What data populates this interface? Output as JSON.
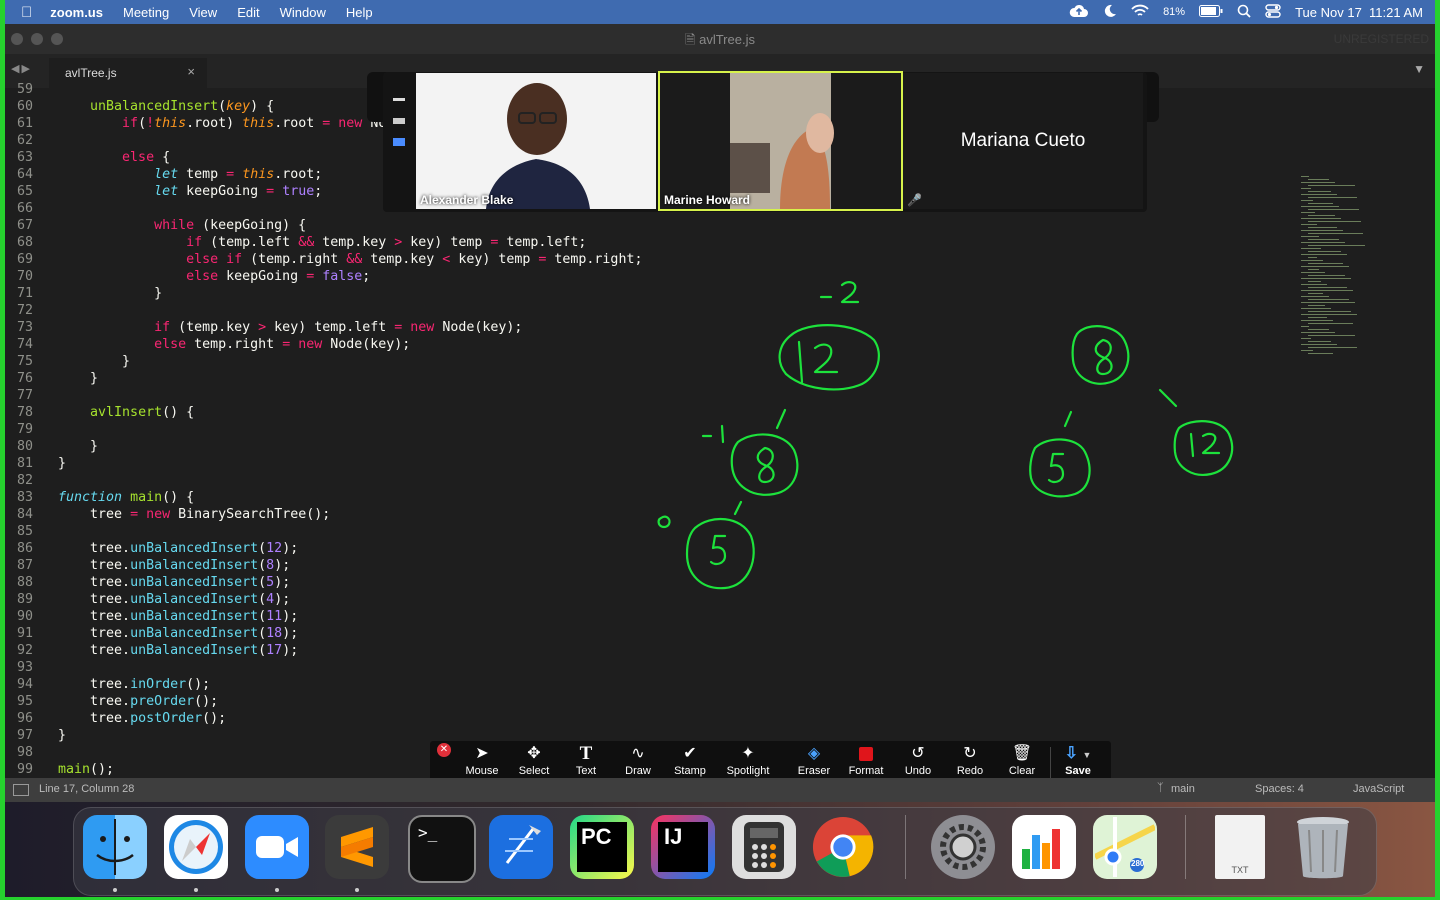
{
  "menubar": {
    "app_name": "zoom.us",
    "items": [
      "Meeting",
      "View",
      "Edit",
      "Window",
      "Help"
    ],
    "battery": "81%",
    "clock": "Tue Nov 17  11:21 AM"
  },
  "editor": {
    "title": "avlTree.js",
    "unregistered": "UNREGISTERED",
    "tab_name": "avlTree.js",
    "status_position": "Line 17, Column 28",
    "branch": "main",
    "spaces": "Spaces: 4",
    "language": "JavaScript"
  },
  "code_lines": [
    {
      "n": "59",
      "t": []
    },
    {
      "n": "60",
      "t": [
        [
          "    ",
          ""
        ],
        [
          "unBalancedInsert",
          "fn"
        ],
        [
          "(",
          ""
        ],
        [
          "key",
          "th"
        ],
        [
          ") {",
          ""
        ]
      ]
    },
    {
      "n": "61",
      "t": [
        [
          "        ",
          ""
        ],
        [
          "if",
          "kw"
        ],
        [
          "(",
          ""
        ],
        [
          "!",
          "kw"
        ],
        [
          "this",
          "th"
        ],
        [
          ".root) ",
          ""
        ],
        [
          "this",
          "th"
        ],
        [
          ".root ",
          ""
        ],
        [
          "=",
          "kw"
        ],
        [
          " ",
          ""
        ],
        [
          "new",
          "kw"
        ],
        [
          " Node(key);",
          ""
        ]
      ]
    },
    {
      "n": "62",
      "t": []
    },
    {
      "n": "63",
      "t": [
        [
          "        ",
          ""
        ],
        [
          "else",
          "kw"
        ],
        [
          " {",
          ""
        ]
      ]
    },
    {
      "n": "64",
      "t": [
        [
          "            ",
          ""
        ],
        [
          "let",
          "st"
        ],
        [
          " temp ",
          ""
        ],
        [
          "=",
          "kw"
        ],
        [
          " ",
          ""
        ],
        [
          "this",
          "th"
        ],
        [
          ".root;",
          ""
        ]
      ]
    },
    {
      "n": "65",
      "t": [
        [
          "            ",
          ""
        ],
        [
          "let",
          "st"
        ],
        [
          " keepGoing ",
          ""
        ],
        [
          "=",
          "kw"
        ],
        [
          " ",
          ""
        ],
        [
          "true",
          "bl"
        ],
        [
          ";",
          ""
        ]
      ]
    },
    {
      "n": "66",
      "t": []
    },
    {
      "n": "67",
      "t": [
        [
          "            ",
          ""
        ],
        [
          "while",
          "kw"
        ],
        [
          " (keepGoing) {",
          ""
        ]
      ]
    },
    {
      "n": "68",
      "t": [
        [
          "                ",
          ""
        ],
        [
          "if",
          "kw"
        ],
        [
          " (temp.left ",
          ""
        ],
        [
          "&&",
          "kw"
        ],
        [
          " temp.key ",
          ""
        ],
        [
          ">",
          "kw"
        ],
        [
          " key) temp ",
          ""
        ],
        [
          "=",
          "kw"
        ],
        [
          " temp.left;",
          ""
        ]
      ]
    },
    {
      "n": "69",
      "t": [
        [
          "                ",
          ""
        ],
        [
          "else if",
          "kw"
        ],
        [
          " (temp.right ",
          ""
        ],
        [
          "&&",
          "kw"
        ],
        [
          " temp.key ",
          ""
        ],
        [
          "<",
          "kw"
        ],
        [
          " key) temp ",
          ""
        ],
        [
          "=",
          "kw"
        ],
        [
          " temp.right;",
          ""
        ]
      ]
    },
    {
      "n": "70",
      "t": [
        [
          "                ",
          ""
        ],
        [
          "else",
          "kw"
        ],
        [
          " keepGoing ",
          ""
        ],
        [
          "=",
          "kw"
        ],
        [
          " ",
          ""
        ],
        [
          "false",
          "bl"
        ],
        [
          ";",
          ""
        ]
      ]
    },
    {
      "n": "71",
      "t": [
        [
          "            }",
          ""
        ]
      ]
    },
    {
      "n": "72",
      "t": []
    },
    {
      "n": "73",
      "t": [
        [
          "            ",
          ""
        ],
        [
          "if",
          "kw"
        ],
        [
          " (temp.key ",
          ""
        ],
        [
          ">",
          "kw"
        ],
        [
          " key) temp.left ",
          ""
        ],
        [
          "=",
          "kw"
        ],
        [
          " ",
          ""
        ],
        [
          "new",
          "kw"
        ],
        [
          " Node(key);",
          ""
        ]
      ]
    },
    {
      "n": "74",
      "t": [
        [
          "            ",
          ""
        ],
        [
          "else",
          "kw"
        ],
        [
          " temp.right ",
          ""
        ],
        [
          "=",
          "kw"
        ],
        [
          " ",
          ""
        ],
        [
          "new",
          "kw"
        ],
        [
          " Node(key);",
          ""
        ]
      ]
    },
    {
      "n": "75",
      "t": [
        [
          "        }",
          ""
        ]
      ]
    },
    {
      "n": "76",
      "t": [
        [
          "    }",
          ""
        ]
      ]
    },
    {
      "n": "77",
      "t": []
    },
    {
      "n": "78",
      "t": [
        [
          "    ",
          ""
        ],
        [
          "avlInsert",
          "fn"
        ],
        [
          "() {",
          ""
        ]
      ]
    },
    {
      "n": "79",
      "t": []
    },
    {
      "n": "80",
      "t": [
        [
          "    }",
          ""
        ]
      ]
    },
    {
      "n": "81",
      "t": [
        [
          "}",
          ""
        ]
      ]
    },
    {
      "n": "82",
      "t": []
    },
    {
      "n": "83",
      "t": [
        [
          "function",
          "st"
        ],
        [
          " ",
          ""
        ],
        [
          "main",
          "fn"
        ],
        [
          "() {",
          ""
        ]
      ]
    },
    {
      "n": "84",
      "t": [
        [
          "    tree ",
          ""
        ],
        [
          "=",
          "kw"
        ],
        [
          " ",
          ""
        ],
        [
          "new",
          "kw"
        ],
        [
          " BinarySearchTree();",
          ""
        ]
      ]
    },
    {
      "n": "85",
      "t": []
    },
    {
      "n": "86",
      "t": [
        [
          "    tree.",
          ""
        ],
        [
          "unBalancedInsert",
          "me"
        ],
        [
          "(",
          ""
        ],
        [
          "12",
          "nu"
        ],
        [
          ");",
          ""
        ]
      ]
    },
    {
      "n": "87",
      "t": [
        [
          "    tree.",
          ""
        ],
        [
          "unBalancedInsert",
          "me"
        ],
        [
          "(",
          ""
        ],
        [
          "8",
          "nu"
        ],
        [
          ");",
          ""
        ]
      ]
    },
    {
      "n": "88",
      "t": [
        [
          "    tree.",
          ""
        ],
        [
          "unBalancedInsert",
          "me"
        ],
        [
          "(",
          ""
        ],
        [
          "5",
          "nu"
        ],
        [
          ");",
          ""
        ]
      ]
    },
    {
      "n": "89",
      "t": [
        [
          "    tree.",
          ""
        ],
        [
          "unBalancedInsert",
          "me"
        ],
        [
          "(",
          ""
        ],
        [
          "4",
          "nu"
        ],
        [
          ");",
          ""
        ]
      ]
    },
    {
      "n": "90",
      "t": [
        [
          "    tree.",
          ""
        ],
        [
          "unBalancedInsert",
          "me"
        ],
        [
          "(",
          ""
        ],
        [
          "11",
          "nu"
        ],
        [
          ");",
          ""
        ]
      ]
    },
    {
      "n": "91",
      "t": [
        [
          "    tree.",
          ""
        ],
        [
          "unBalancedInsert",
          "me"
        ],
        [
          "(",
          ""
        ],
        [
          "18",
          "nu"
        ],
        [
          ");",
          ""
        ]
      ]
    },
    {
      "n": "92",
      "t": [
        [
          "    tree.",
          ""
        ],
        [
          "unBalancedInsert",
          "me"
        ],
        [
          "(",
          ""
        ],
        [
          "17",
          "nu"
        ],
        [
          ");",
          ""
        ]
      ]
    },
    {
      "n": "93",
      "t": []
    },
    {
      "n": "94",
      "t": [
        [
          "    tree.",
          ""
        ],
        [
          "inOrder",
          "me"
        ],
        [
          "();",
          ""
        ]
      ]
    },
    {
      "n": "95",
      "t": [
        [
          "    tree.",
          ""
        ],
        [
          "preOrder",
          "me"
        ],
        [
          "();",
          ""
        ]
      ]
    },
    {
      "n": "96",
      "t": [
        [
          "    tree.",
          ""
        ],
        [
          "postOrder",
          "me"
        ],
        [
          "();",
          ""
        ]
      ]
    },
    {
      "n": "97",
      "t": [
        [
          "}",
          ""
        ]
      ]
    },
    {
      "n": "98",
      "t": []
    },
    {
      "n": "99",
      "t": [
        [
          "main",
          "fn"
        ],
        [
          "();",
          ""
        ]
      ]
    }
  ],
  "participants": [
    {
      "name": "Alexander Blake"
    },
    {
      "name": "Marine Howard"
    },
    {
      "name": "Mariana Cueto"
    }
  ],
  "annotation_toolbar": {
    "tools": [
      {
        "label": "Mouse",
        "icon": "cursor-icon"
      },
      {
        "label": "Select",
        "icon": "move-icon"
      },
      {
        "label": "Text",
        "icon": "text-icon"
      },
      {
        "label": "Draw",
        "icon": "draw-icon"
      },
      {
        "label": "Stamp",
        "icon": "checkmark-icon"
      },
      {
        "label": "Spotlight",
        "icon": "spotlight-icon"
      },
      {
        "label": "Eraser",
        "icon": "eraser-icon"
      },
      {
        "label": "Format",
        "icon": "format-icon"
      },
      {
        "label": "Undo",
        "icon": "undo-icon"
      },
      {
        "label": "Redo",
        "icon": "redo-icon"
      },
      {
        "label": "Clear",
        "icon": "trash-icon"
      },
      {
        "label": "Save",
        "icon": "save-icon"
      }
    ],
    "active": "Eraser"
  },
  "colors": {
    "annotation": "#1de23c",
    "zoom_active": "#d7f24b",
    "editor_bg": "#1e1e1e",
    "menubar": "#3f6bb0"
  },
  "dock": [
    {
      "name": "finder-app"
    },
    {
      "name": "safari-app"
    },
    {
      "name": "zoom-app"
    },
    {
      "name": "sublime-text-app"
    },
    {
      "name": "terminal-app"
    },
    {
      "name": "xcode-app"
    },
    {
      "name": "pycharm-app",
      "text": "PC"
    },
    {
      "name": "intellij-app",
      "text": "IJ"
    },
    {
      "name": "calculator-app"
    },
    {
      "name": "chrome-app"
    },
    {
      "name": "system-preferences-app"
    },
    {
      "name": "numbers-app"
    },
    {
      "name": "maps-app",
      "text": "280"
    },
    {
      "name": "txt-document",
      "text": "TXT"
    },
    {
      "name": "trash-app"
    }
  ]
}
